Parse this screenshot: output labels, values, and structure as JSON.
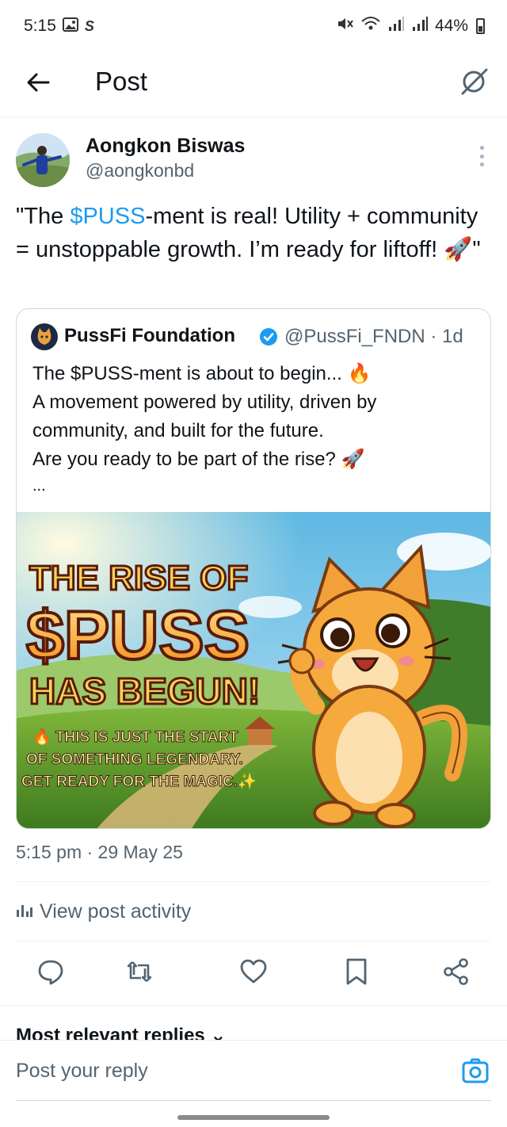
{
  "status_bar": {
    "time": "5:15",
    "battery": "44%",
    "icons": [
      "gallery-icon",
      "s-app-icon",
      "mute-icon",
      "wifi-icon",
      "signal-icon",
      "signal-icon",
      "battery-icon"
    ]
  },
  "header": {
    "title": "Post",
    "back_icon": "arrow-left-icon",
    "grok_icon": "grok-icon"
  },
  "post": {
    "author_name": "Aongkon Biswas",
    "author_handle": "@aongkonbd",
    "text_open": "\"The ",
    "cashtag": "$PUSS",
    "text_rest": "-ment is real! Utility + community = unstoppable growth. I’m ready for liftoff! 🚀\"",
    "timestamp": "5:15 pm · 29 May 25"
  },
  "quote": {
    "author_name": "PussFi Foundation",
    "handle_time": "@PussFi_FNDN · 1d",
    "lines": [
      "The $PUSS-ment is about to begin... 🔥",
      "A movement powered by utility, driven by",
      "community, and built for the future.",
      "Are you ready to be part of the rise? 🚀",
      "..."
    ],
    "image": {
      "line1": "THE RISE OF",
      "line2": "$PUSS",
      "line3": "HAS BEGUN!",
      "sub1": "🔥 THIS IS JUST THE START",
      "sub2": "OF SOMETHING LEGENDARY.",
      "sub3": "GET READY FOR THE MAGIC.✨"
    }
  },
  "activity": {
    "label": "View post activity",
    "icon": "bar-chart-icon"
  },
  "actions": [
    "reply-icon",
    "repost-icon",
    "like-icon",
    "bookmark-icon",
    "share-icon"
  ],
  "replies_heading": "Most relevant replies ⌄",
  "reply_box": {
    "placeholder": "Post your reply",
    "camera_icon": "camera-icon"
  },
  "colors": {
    "accent": "#1d9bf0",
    "text": "#0f1419",
    "secondary": "#536471",
    "border": "#cfd9de"
  }
}
